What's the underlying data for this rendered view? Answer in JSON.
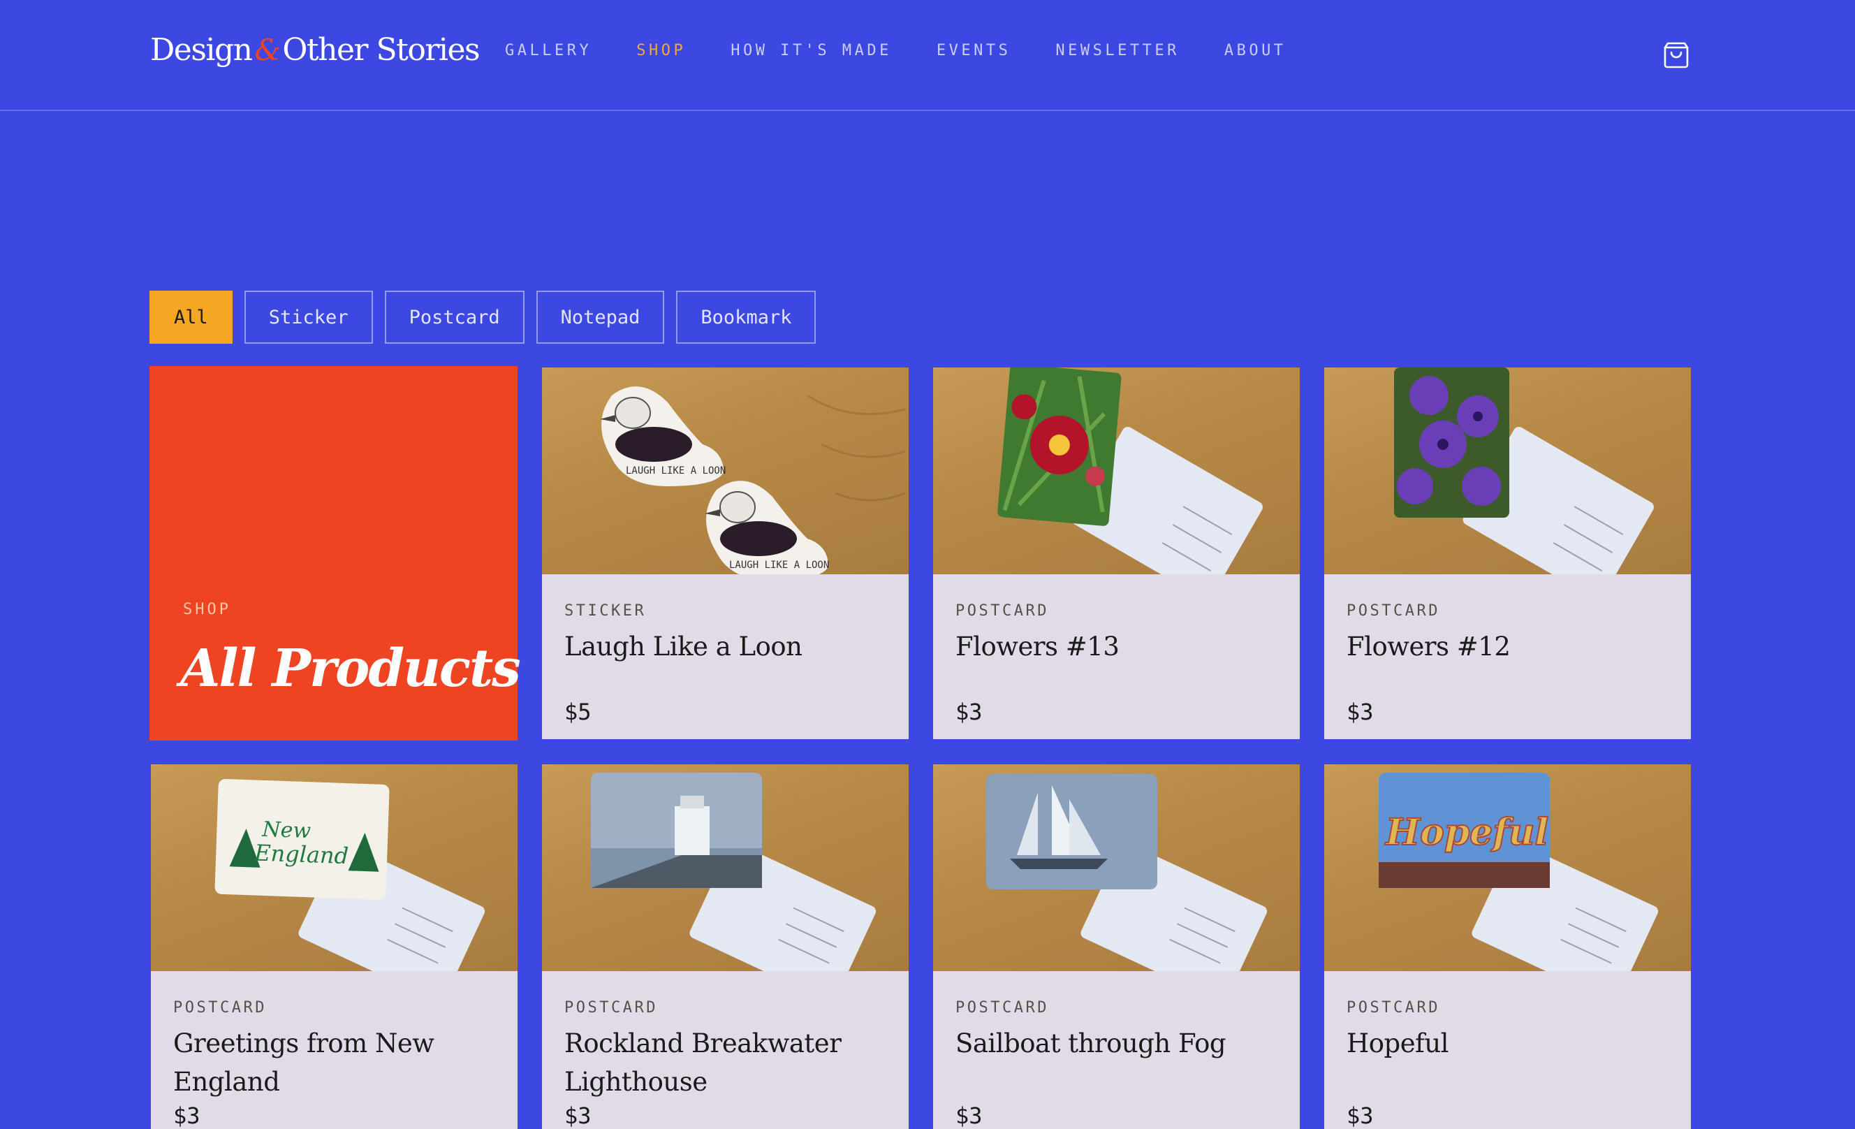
{
  "brand": {
    "name_part1": "Design",
    "amp": "&",
    "name_part2": "Other Stories"
  },
  "nav": {
    "items": [
      {
        "label": "GALLERY",
        "active": false
      },
      {
        "label": "SHOP",
        "active": true
      },
      {
        "label": "HOW IT'S MADE",
        "active": false
      },
      {
        "label": "EVENTS",
        "active": false
      },
      {
        "label": "NEWSLETTER",
        "active": false
      },
      {
        "label": "ABOUT",
        "active": false
      }
    ],
    "cart_icon": "shopping-bag-icon"
  },
  "filters": [
    {
      "label": "All",
      "active": true
    },
    {
      "label": "Sticker",
      "active": false
    },
    {
      "label": "Postcard",
      "active": false
    },
    {
      "label": "Notepad",
      "active": false
    },
    {
      "label": "Bookmark",
      "active": false
    }
  ],
  "hero": {
    "eyebrow": "SHOP",
    "title": "All Products"
  },
  "products": [
    {
      "category": "STICKER",
      "name": "Laugh Like a Loon",
      "price": "$5",
      "image": "loon-stickers"
    },
    {
      "category": "POSTCARD",
      "name": "Flowers #13",
      "price": "$3",
      "image": "red-lily-postcard"
    },
    {
      "category": "POSTCARD",
      "name": "Flowers #12",
      "price": "$3",
      "image": "purple-petunia-postcard"
    },
    {
      "category": "POSTCARD",
      "name": "Greetings from New England",
      "price": "$3",
      "image": "new-england-postcard"
    },
    {
      "category": "POSTCARD",
      "name": "Rockland Breakwater Lighthouse",
      "price": "$3",
      "image": "lighthouse-postcard"
    },
    {
      "category": "POSTCARD",
      "name": "Sailboat through Fog",
      "price": "$3",
      "image": "sailboat-postcard"
    },
    {
      "category": "POSTCARD",
      "name": "Hopeful",
      "price": "$3",
      "image": "hopeful-sign-postcard"
    }
  ],
  "colors": {
    "background": "#3c48e1",
    "accent_orange": "#ee4422",
    "accent_yellow": "#f5a623",
    "card_bg": "#e0dbe6"
  }
}
